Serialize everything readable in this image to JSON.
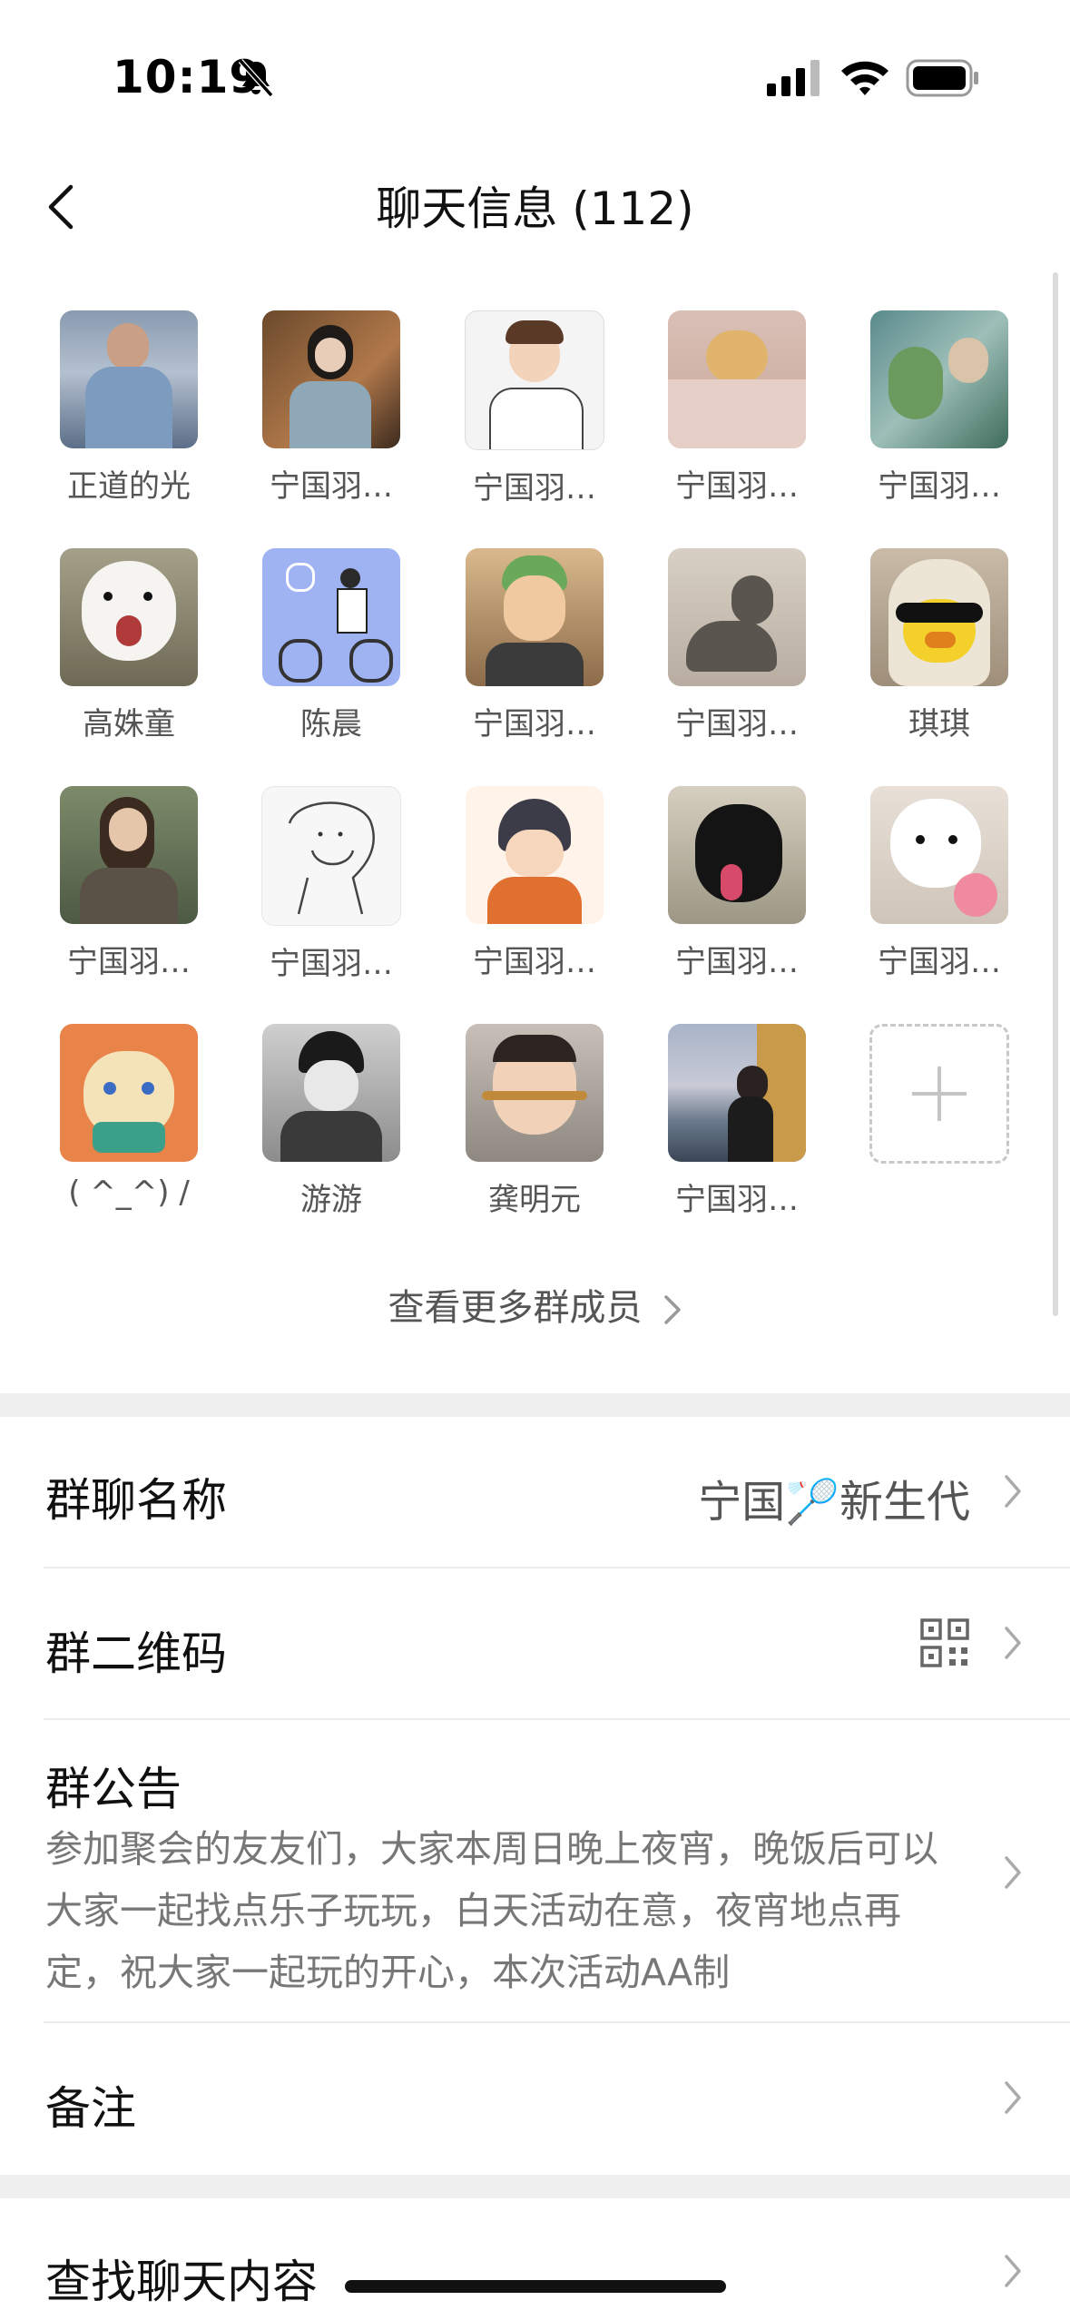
{
  "status_bar": {
    "time": "10:19"
  },
  "nav": {
    "title": "聊天信息 (112)"
  },
  "members": [
    {
      "name": "正道的光"
    },
    {
      "name": "宁国羽…"
    },
    {
      "name": "宁国羽…"
    },
    {
      "name": "宁国羽…"
    },
    {
      "name": "宁国羽…"
    },
    {
      "name": "高姝童"
    },
    {
      "name": "陈晨"
    },
    {
      "name": "宁国羽…"
    },
    {
      "name": "宁国羽…"
    },
    {
      "name": "琪琪"
    },
    {
      "name": "宁国羽…"
    },
    {
      "name": "宁国羽…"
    },
    {
      "name": "宁国羽…"
    },
    {
      "name": "宁国羽…"
    },
    {
      "name": "宁国羽…"
    },
    {
      "name": "( ^_^) /"
    },
    {
      "name": "游游"
    },
    {
      "name": "龚明元"
    },
    {
      "name": "宁国羽…"
    }
  ],
  "more_members": "查看更多群成员",
  "settings": {
    "group_name_label": "群聊名称",
    "group_name_value": "宁国🏸新生代",
    "qr_label": "群二维码",
    "notice_label": "群公告",
    "notice_text": "参加聚会的友友们，大家本周日晚上夜宵，晚饭后可以大家一起找点乐子玩玩，白天活动在意，夜宵地点再定，祝大家一起玩的开心，本次活动AA制",
    "remark_label": "备注",
    "search_label": "查找聊天内容"
  }
}
